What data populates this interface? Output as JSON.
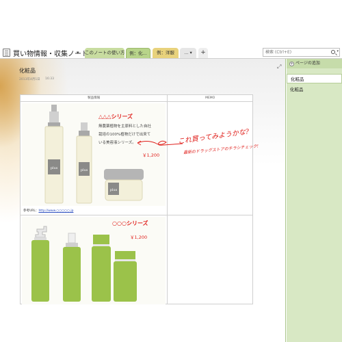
{
  "notebook": {
    "title": "買い物情報・収集ノート"
  },
  "tabs": [
    {
      "label": "このノートの使い方",
      "color": "#c8dca0"
    },
    {
      "label": "例：化...",
      "color": "#b8d48a"
    },
    {
      "label": "例：洋服",
      "color": "#e8d27c"
    },
    {
      "label": "...",
      "color": "#e6e6e6"
    },
    {
      "label": "+",
      "color": "#eeeeee"
    }
  ],
  "search": {
    "placeholder": "検索 (Ctrl+E)"
  },
  "page": {
    "title": "化粧品",
    "date": "2013年4月1日",
    "time": "16:33"
  },
  "table": {
    "headers": [
      "製品情報",
      "MEMO"
    ],
    "products": [
      {
        "series": "△△△シリーズ",
        "description": [
          "無農薬植物を主原料とした自社",
          "栽培の100%植物だけで出来て",
          "いる美容液シリーズ。"
        ],
        "price": "￥1,200",
        "brand_label": "plus",
        "ref_label": "参考URL：",
        "ref_url": "http://www.○○○○○.jp"
      },
      {
        "series": "○○○シリーズ",
        "price": "￥1,200"
      }
    ],
    "memo": {
      "line1": "これ買ってみようかな?",
      "line2": "最新のドラッグストアのチラシチェック!"
    }
  },
  "sidebar": {
    "add_page": "ページの追加",
    "items": [
      "化粧品",
      "化粧品"
    ]
  },
  "colors": {
    "accent_red": "#e0201c",
    "sidebar_green": "#d8e8c4",
    "link_blue": "#2a4dbf"
  }
}
